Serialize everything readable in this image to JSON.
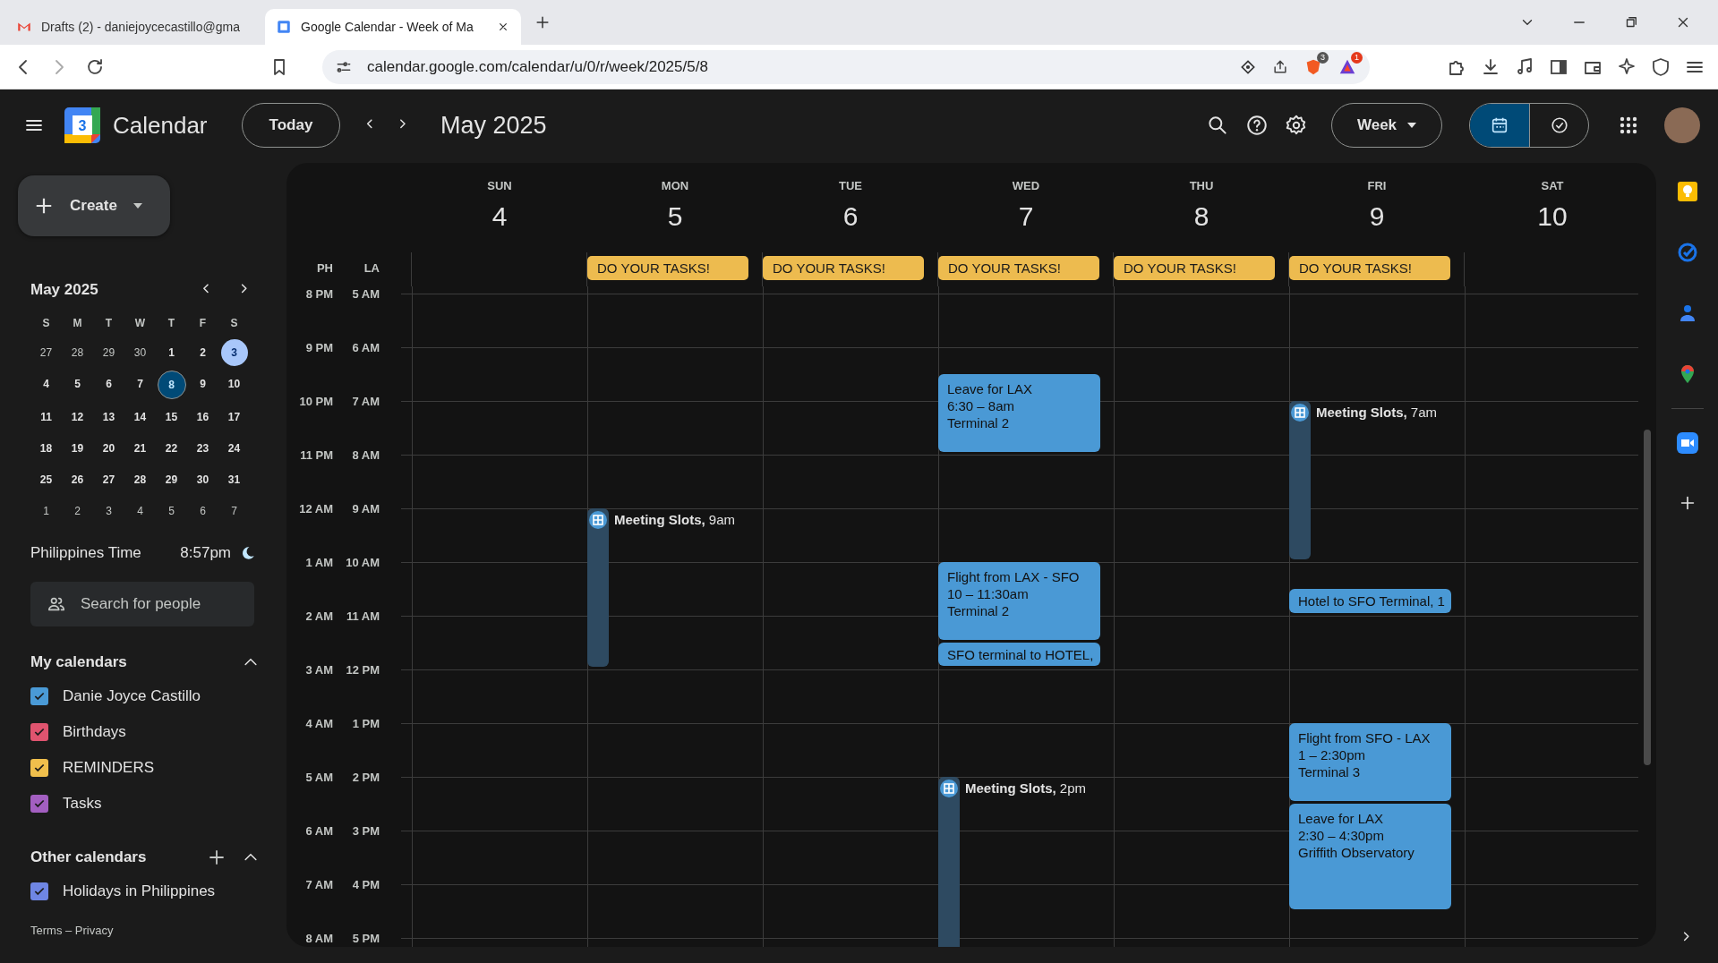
{
  "browser": {
    "tabs": [
      {
        "title": "Drafts (2) - daniejoycecastillo@gma",
        "selected": false
      },
      {
        "title": "Google Calendar - Week of Ma",
        "selected": true
      }
    ],
    "address": "calendar.google.com/calendar/u/0/r/week/2025/5/8",
    "shield_badge": "3",
    "alert_badge": "1"
  },
  "header": {
    "logo_digit": "3",
    "app_name": "Calendar",
    "today_button": "Today",
    "period": "May 2025",
    "view": "Week",
    "view_toggle": [
      {
        "kind": "calendar",
        "selected": true
      },
      {
        "kind": "tasks",
        "selected": false
      }
    ]
  },
  "sidebar": {
    "create": "Create",
    "mini_calendar": {
      "title": "May 2025",
      "weekdays": [
        "S",
        "M",
        "T",
        "W",
        "T",
        "F",
        "S"
      ],
      "weeks": [
        [
          {
            "label": "27",
            "outside": true,
            "selected": false,
            "today": false
          },
          {
            "label": "28",
            "outside": true,
            "selected": false,
            "today": false
          },
          {
            "label": "29",
            "outside": true,
            "selected": false,
            "today": false
          },
          {
            "label": "30",
            "outside": true,
            "selected": false,
            "today": false
          },
          {
            "label": "1",
            "outside": false,
            "selected": false,
            "today": false
          },
          {
            "label": "2",
            "outside": false,
            "selected": false,
            "today": false
          },
          {
            "label": "3",
            "outside": false,
            "selected": true,
            "today": false
          }
        ],
        [
          {
            "label": "4",
            "outside": false,
            "selected": false,
            "today": false
          },
          {
            "label": "5",
            "outside": false,
            "selected": false,
            "today": false
          },
          {
            "label": "6",
            "outside": false,
            "selected": false,
            "today": false
          },
          {
            "label": "7",
            "outside": false,
            "selected": false,
            "today": false
          },
          {
            "label": "8",
            "outside": false,
            "selected": false,
            "today": true
          },
          {
            "label": "9",
            "outside": false,
            "selected": false,
            "today": false
          },
          {
            "label": "10",
            "outside": false,
            "selected": false,
            "today": false
          }
        ],
        [
          {
            "label": "11",
            "outside": false,
            "selected": false,
            "today": false
          },
          {
            "label": "12",
            "outside": false,
            "selected": false,
            "today": false
          },
          {
            "label": "13",
            "outside": false,
            "selected": false,
            "today": false
          },
          {
            "label": "14",
            "outside": false,
            "selected": false,
            "today": false
          },
          {
            "label": "15",
            "outside": false,
            "selected": false,
            "today": false
          },
          {
            "label": "16",
            "outside": false,
            "selected": false,
            "today": false
          },
          {
            "label": "17",
            "outside": false,
            "selected": false,
            "today": false
          }
        ],
        [
          {
            "label": "18",
            "outside": false,
            "selected": false,
            "today": false
          },
          {
            "label": "19",
            "outside": false,
            "selected": false,
            "today": false
          },
          {
            "label": "20",
            "outside": false,
            "selected": false,
            "today": false
          },
          {
            "label": "21",
            "outside": false,
            "selected": false,
            "today": false
          },
          {
            "label": "22",
            "outside": false,
            "selected": false,
            "today": false
          },
          {
            "label": "23",
            "outside": false,
            "selected": false,
            "today": false
          },
          {
            "label": "24",
            "outside": false,
            "selected": false,
            "today": false
          }
        ],
        [
          {
            "label": "25",
            "outside": false,
            "selected": false,
            "today": false
          },
          {
            "label": "26",
            "outside": false,
            "selected": false,
            "today": false
          },
          {
            "label": "27",
            "outside": false,
            "selected": false,
            "today": false
          },
          {
            "label": "28",
            "outside": false,
            "selected": false,
            "today": false
          },
          {
            "label": "29",
            "outside": false,
            "selected": false,
            "today": false
          },
          {
            "label": "30",
            "outside": false,
            "selected": false,
            "today": false
          },
          {
            "label": "31",
            "outside": false,
            "selected": false,
            "today": false
          }
        ],
        [
          {
            "label": "1",
            "outside": true,
            "selected": false,
            "today": false
          },
          {
            "label": "2",
            "outside": true,
            "selected": false,
            "today": false
          },
          {
            "label": "3",
            "outside": true,
            "selected": false,
            "today": false
          },
          {
            "label": "4",
            "outside": true,
            "selected": false,
            "today": false
          },
          {
            "label": "5",
            "outside": true,
            "selected": false,
            "today": false
          },
          {
            "label": "6",
            "outside": true,
            "selected": false,
            "today": false
          },
          {
            "label": "7",
            "outside": true,
            "selected": false,
            "today": false
          }
        ]
      ]
    },
    "world_clock": {
      "label": "Philippines Time",
      "time": "8:57pm"
    },
    "search_people": {
      "placeholder": "Search for people"
    },
    "my_calendars": {
      "title": "My calendars",
      "expanded": true,
      "items": [
        {
          "name": "Danie Joyce Castillo",
          "checked": true,
          "color": "#4a9ad6"
        },
        {
          "name": "Birthdays",
          "checked": true,
          "color": "#e0546f"
        },
        {
          "name": "REMINDERS",
          "checked": true,
          "color": "#f0bf4c"
        },
        {
          "name": "Tasks",
          "checked": true,
          "color": "#a35fc1"
        }
      ]
    },
    "other_calendars": {
      "title": "Other calendars",
      "expanded": true,
      "items": [
        {
          "name": "Holidays in Philippines",
          "checked": true,
          "color": "#6f86e4"
        }
      ]
    },
    "footer": "Terms – Privacy"
  },
  "grid": {
    "time_zones": [
      "PH",
      "LA"
    ],
    "hours": [
      {
        "ph": "8 PM",
        "la": "5 AM"
      },
      {
        "ph": "9 PM",
        "la": "6 AM"
      },
      {
        "ph": "10 PM",
        "la": "7 AM"
      },
      {
        "ph": "11 PM",
        "la": "8 AM"
      },
      {
        "ph": "12 AM",
        "la": "9 AM"
      },
      {
        "ph": "1 AM",
        "la": "10 AM"
      },
      {
        "ph": "2 AM",
        "la": "11 AM"
      },
      {
        "ph": "3 AM",
        "la": "12 PM"
      },
      {
        "ph": "4 AM",
        "la": "1 PM"
      },
      {
        "ph": "5 AM",
        "la": "2 PM"
      },
      {
        "ph": "6 AM",
        "la": "3 PM"
      },
      {
        "ph": "7 AM",
        "la": "4 PM"
      },
      {
        "ph": "8 AM",
        "la": "5 PM"
      }
    ],
    "days": [
      {
        "name": "SUN",
        "date": "4"
      },
      {
        "name": "MON",
        "date": "5",
        "all_day": "DO YOUR TASKS!",
        "events": [
          {
            "kind": "slot",
            "title": "**Meeting Slots,** 9am"
          }
        ]
      },
      {
        "name": "TUE",
        "date": "6",
        "all_day": "DO YOUR TASKS!"
      },
      {
        "name": "WED",
        "date": "7",
        "all_day": "DO YOUR TASKS!",
        "events": [
          {
            "kind": "block",
            "title": "Leave for LAX",
            "time": "6:30 – 8am",
            "place": "Terminal 2"
          },
          {
            "kind": "block",
            "title": "Flight from LAX - SFO",
            "time": "10 – 11:30am",
            "place": "Terminal 2"
          },
          {
            "kind": "short",
            "title": "SFO terminal to HOTEL,"
          },
          {
            "kind": "slot",
            "title": "**Meeting Slots,** 2pm"
          }
        ]
      },
      {
        "name": "THU",
        "date": "8",
        "all_day": "DO YOUR TASKS!"
      },
      {
        "name": "FRI",
        "date": "9",
        "all_day": "DO YOUR TASKS!",
        "events": [
          {
            "kind": "slot",
            "title": "**Meeting Slots,** 7am"
          },
          {
            "kind": "short",
            "title": "Hotel to SFO Terminal, 1"
          },
          {
            "kind": "block",
            "title": "Flight from SFO - LAX",
            "time": "1 – 2:30pm",
            "place": "Terminal 3"
          },
          {
            "kind": "block",
            "title": "Leave for LAX",
            "time": "2:30 – 4:30pm",
            "place": "Griffith Observatory"
          }
        ]
      },
      {
        "name": "SAT",
        "date": "10"
      }
    ]
  }
}
